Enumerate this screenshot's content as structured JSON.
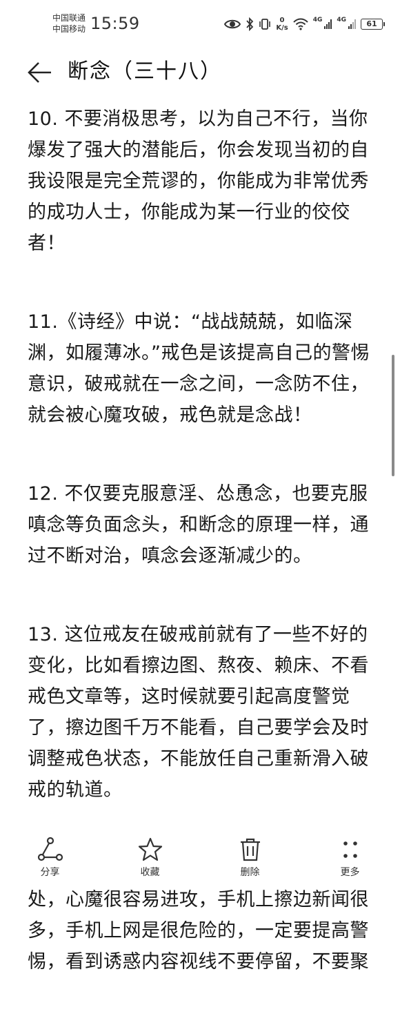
{
  "status_bar": {
    "carrier1": "中国联通",
    "carrier2": "中国移动",
    "time": "15:59",
    "speed_value": "0",
    "speed_unit": "K/s",
    "net1": "4G",
    "net2": "4G",
    "battery": "61"
  },
  "header": {
    "title": "断念（三十八）"
  },
  "content": {
    "paragraphs": [
      "10. 不要消极思考，以为自己不行，当你爆发了强大的潜能后，你会发现当初的自我设限是完全荒谬的，你能成为非常优秀的成功人士，你能成为某一行业的佼佼者！",
      "11.《诗经》中说：“战战兢兢，如临深渊，如履薄冰。”戒色是该提高自己的警惕意识，破戒就在一念之间，一念防不住，就会被心魔攻破，戒色就是念战！",
      "12. 不仅要克服意淫、怂恿念，也要克服嗔念等负面念头，和断念的原理一样，通过不断对治，嗔念会逐渐减少的。",
      "13. 这位戒友在破戒前就有了一些不好的变化，比如看擦边图、熬夜、赖床、不看戒色文章等，这时候就要引起高度警觉了，擦边图千万不能看，自己要学会及时调整戒色状态，不能放任自己重新滑入破戒的轨道。",
      "14. 躺着很容易放松警惕，又是一个人独处，心魔很容易进攻，手机上擦边新闻很多，手机上网是很危险的，一定要提高警惕，看到诱惑内容视线不要停留，不要聚"
    ]
  },
  "toolbar": {
    "share": "分享",
    "favorite": "收藏",
    "delete": "删除",
    "more": "更多"
  }
}
